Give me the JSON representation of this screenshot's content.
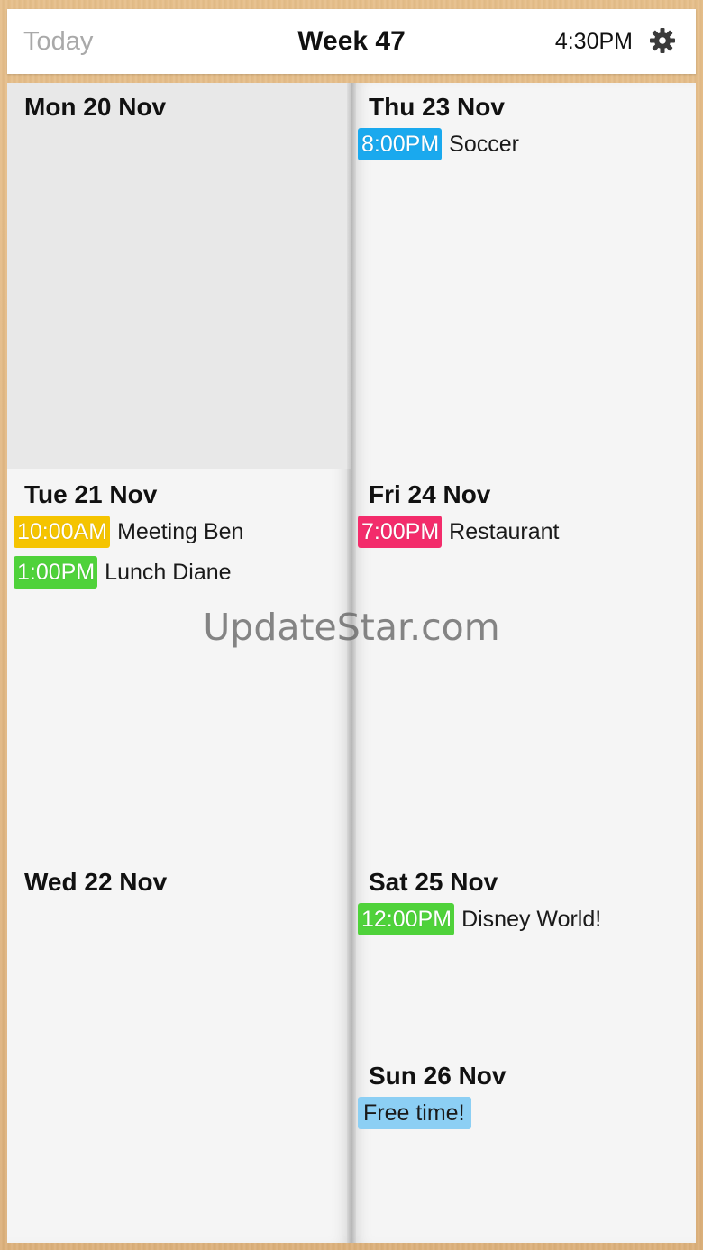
{
  "header": {
    "today_label": "Today",
    "week_title": "Week 47",
    "time": "4:30PM",
    "settings_icon": "gear-icon"
  },
  "days": {
    "mon": {
      "label": "Mon 20 Nov",
      "events": []
    },
    "tue": {
      "label": "Tue 21 Nov",
      "events": [
        {
          "time": "10:00AM",
          "title": "Meeting Ben",
          "color": "#f5c400"
        },
        {
          "time": "1:00PM",
          "title": "Lunch Diane",
          "color": "#4fd23a"
        }
      ]
    },
    "wed": {
      "label": "Wed 22 Nov",
      "events": []
    },
    "thu": {
      "label": "Thu 23 Nov",
      "events": [
        {
          "time": "8:00PM",
          "title": "Soccer",
          "color": "#1aa9ee"
        }
      ]
    },
    "fri": {
      "label": "Fri 24 Nov",
      "events": [
        {
          "time": "7:00PM",
          "title": "Restaurant",
          "color": "#f32c6b"
        }
      ]
    },
    "sat": {
      "label": "Sat 25 Nov",
      "events": [
        {
          "time": "12:00PM",
          "title": "Disney World!",
          "color": "#4fd23a"
        }
      ]
    },
    "sun": {
      "label": "Sun 26 Nov",
      "events": [
        {
          "tag": "Free time!",
          "color": "#8ccff4"
        }
      ]
    }
  },
  "watermark": "UpdateStar.com",
  "colors": {
    "today_highlight": "#e8e8e8",
    "page": "#f5f5f5",
    "wood": "#e2b883"
  }
}
